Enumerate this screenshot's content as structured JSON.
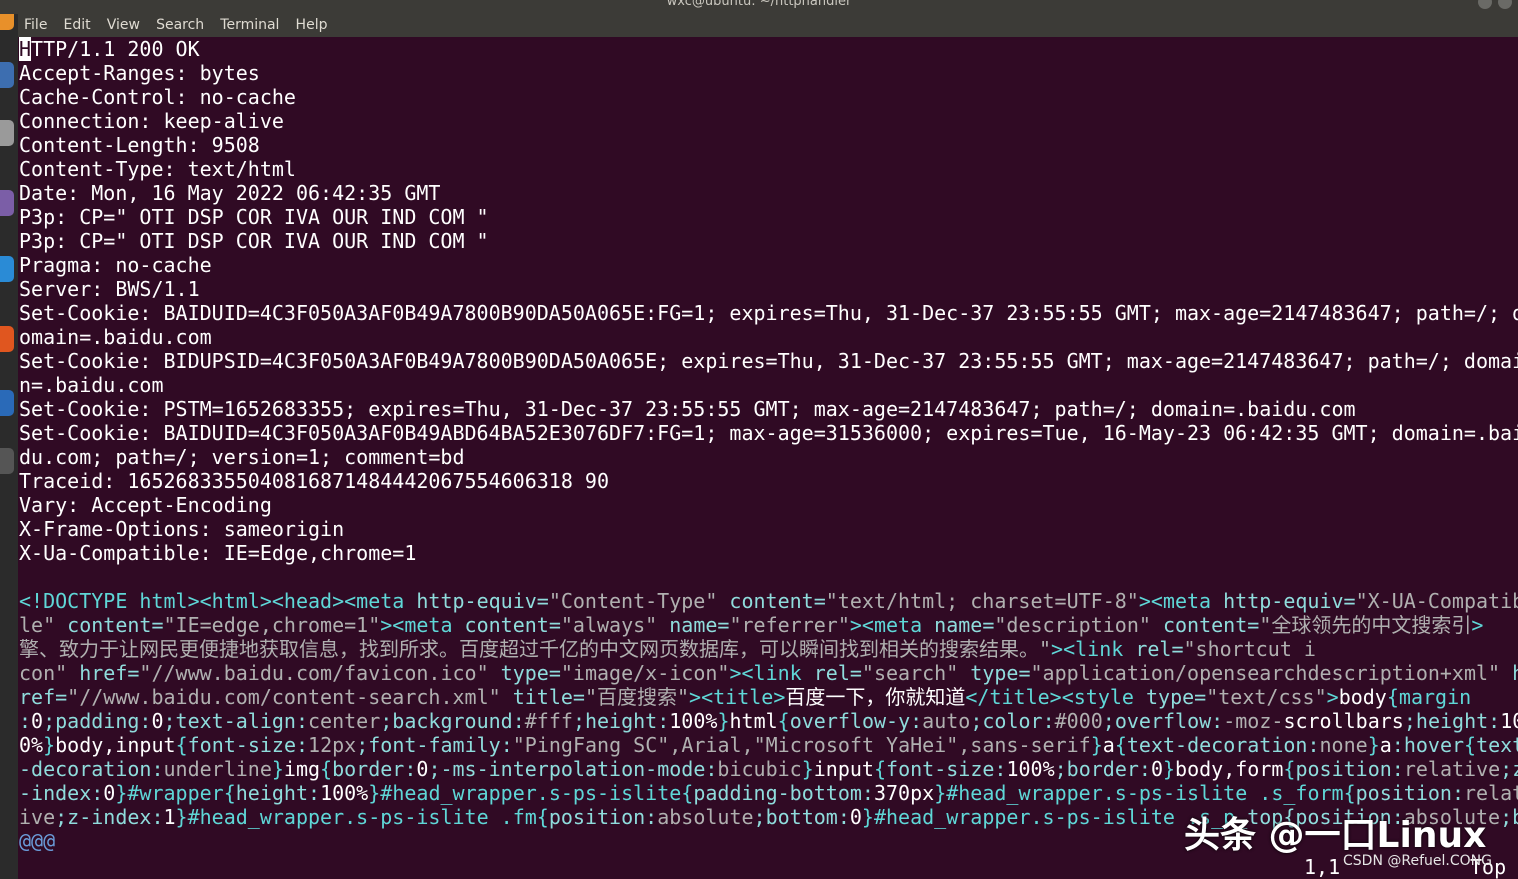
{
  "window": {
    "title": "wxc@ubuntu: ~/httphandler"
  },
  "menu": [
    "File",
    "Edit",
    "View",
    "Search",
    "Terminal",
    "Help"
  ],
  "headers": [
    "HTTP/1.1 200 OK",
    "Accept-Ranges: bytes",
    "Cache-Control: no-cache",
    "Connection: keep-alive",
    "Content-Length: 9508",
    "Content-Type: text/html",
    "Date: Mon, 16 May 2022 06:42:35 GMT",
    "P3p: CP=\" OTI DSP COR IVA OUR IND COM \"",
    "P3p: CP=\" OTI DSP COR IVA OUR IND COM \"",
    "Pragma: no-cache",
    "Server: BWS/1.1",
    "Set-Cookie: BAIDUID=4C3F050A3AF0B49A7800B90DA50A065E:FG=1; expires=Thu, 31-Dec-37 23:55:55 GMT; max-age=2147483647; path=/; d",
    "omain=.baidu.com",
    "Set-Cookie: BIDUPSID=4C3F050A3AF0B49A7800B90DA50A065E; expires=Thu, 31-Dec-37 23:55:55 GMT; max-age=2147483647; path=/; domai",
    "n=.baidu.com",
    "Set-Cookie: PSTM=1652683355; expires=Thu, 31-Dec-37 23:55:55 GMT; max-age=2147483647; path=/; domain=.baidu.com",
    "Set-Cookie: BAIDUID=4C3F050A3AF0B49ABD64BA52E3076DF7:FG=1; max-age=31536000; expires=Tue, 16-May-23 06:42:35 GMT; domain=.bai",
    "du.com; path=/; version=1; comment=bd",
    "Traceid: 1652683355040816871484442067554606318 90",
    "Vary: Accept-Encoding",
    "X-Frame-Options: sameorigin",
    "X-Ua-Compatible: IE=Edge,chrome=1",
    ""
  ],
  "html_lines": [
    [
      [
        "t",
        "<!DOCTYPE html><html><head><meta "
      ],
      [
        "a",
        "http-equiv="
      ],
      [
        "s",
        "\"Content-Type\""
      ],
      [
        "a",
        " content="
      ],
      [
        "s",
        "\"text/html; charset=UTF-8\""
      ],
      [
        "t",
        "><meta "
      ],
      [
        "a",
        "http-equiv="
      ],
      [
        "s",
        "\"X-UA-Compatib"
      ]
    ],
    [
      [
        "s",
        "le\""
      ],
      [
        "a",
        " content="
      ],
      [
        "s",
        "\"IE=edge,chrome=1\""
      ],
      [
        "t",
        "><meta "
      ],
      [
        "a",
        "content="
      ],
      [
        "s",
        "\"always\""
      ],
      [
        "a",
        " name="
      ],
      [
        "s",
        "\"referrer\""
      ],
      [
        "t",
        "><meta "
      ],
      [
        "a",
        "name="
      ],
      [
        "s",
        "\"description\""
      ],
      [
        "a",
        " content="
      ],
      [
        "s",
        "\"全球领先的中文搜索引"
      ],
      [
        "t",
        ">"
      ]
    ],
    [
      [
        "s",
        "擎、致力于让网民更便捷地获取信息，找到所求。百度超过千亿的中文网页数据库，可以瞬间找到相关的搜索结果。\""
      ],
      [
        "t",
        "><link "
      ],
      [
        "a",
        "rel="
      ],
      [
        "s",
        "\"shortcut i"
      ]
    ],
    [
      [
        "s",
        "con\""
      ],
      [
        "a",
        " href="
      ],
      [
        "s",
        "\"//www.baidu.com/favicon.ico\""
      ],
      [
        "a",
        " type="
      ],
      [
        "s",
        "\"image/x-icon\""
      ],
      [
        "t",
        "><link "
      ],
      [
        "a",
        "rel="
      ],
      [
        "s",
        "\"search\""
      ],
      [
        "a",
        " type="
      ],
      [
        "s",
        "\"application/opensearchdescription+xml\""
      ],
      [
        "a",
        " h"
      ]
    ],
    [
      [
        "a",
        "ref="
      ],
      [
        "s",
        "\"//www.baidu.com/content-search.xml\""
      ],
      [
        "a",
        " title="
      ],
      [
        "s",
        "\"百度搜索\""
      ],
      [
        "t",
        "><title>"
      ],
      [
        "tx",
        "百度一下，你就知道"
      ],
      [
        "t",
        "</title><style "
      ],
      [
        "a",
        "type="
      ],
      [
        "s",
        "\"text/css\""
      ],
      [
        "t",
        ">"
      ],
      [
        "tx",
        "body"
      ],
      [
        "t",
        "{margin"
      ]
    ],
    [
      [
        "a",
        ":"
      ],
      [
        "tx",
        "0"
      ],
      [
        "a",
        ";padding:"
      ],
      [
        "tx",
        "0"
      ],
      [
        "a",
        ";text-align:"
      ],
      [
        "s",
        "center"
      ],
      [
        "a",
        ";background:"
      ],
      [
        "s",
        "#fff"
      ],
      [
        "a",
        ";height:"
      ],
      [
        "tx",
        "100%"
      ],
      [
        "t",
        "}"
      ],
      [
        "tx",
        "html"
      ],
      [
        "t",
        "{"
      ],
      [
        "a",
        "overflow-y:"
      ],
      [
        "s",
        "auto"
      ],
      [
        "a",
        ";color:"
      ],
      [
        "s",
        "#000"
      ],
      [
        "a",
        ";overflow:"
      ],
      [
        "s",
        "-moz-"
      ],
      [
        "tx",
        "scrollbars"
      ],
      [
        "a",
        ";height:"
      ],
      [
        "tx",
        "10"
      ]
    ],
    [
      [
        "tx",
        "0%"
      ],
      [
        "t",
        "}"
      ],
      [
        "tx",
        "body,input"
      ],
      [
        "t",
        "{"
      ],
      [
        "a",
        "font-size:"
      ],
      [
        "s",
        "12px"
      ],
      [
        "a",
        ";font-family:"
      ],
      [
        "s",
        "\"PingFang SC\",Arial,\"Microsoft YaHei\",sans-serif"
      ],
      [
        "t",
        "}"
      ],
      [
        "tx",
        "a"
      ],
      [
        "t",
        "{"
      ],
      [
        "a",
        "text-decoration:"
      ],
      [
        "s",
        "none"
      ],
      [
        "t",
        "}"
      ],
      [
        "tx",
        "a"
      ],
      [
        "a",
        ":hover"
      ],
      [
        "t",
        "{"
      ],
      [
        "a",
        "text"
      ]
    ],
    [
      [
        "a",
        "-decoration:"
      ],
      [
        "s",
        "underline"
      ],
      [
        "t",
        "}"
      ],
      [
        "tx",
        "img"
      ],
      [
        "t",
        "{"
      ],
      [
        "a",
        "border:"
      ],
      [
        "tx",
        "0"
      ],
      [
        "a",
        ";-ms-interpolation-mode:"
      ],
      [
        "s",
        "bicubic"
      ],
      [
        "t",
        "}"
      ],
      [
        "tx",
        "input"
      ],
      [
        "t",
        "{"
      ],
      [
        "a",
        "font-size:"
      ],
      [
        "tx",
        "100%"
      ],
      [
        "a",
        ";border:"
      ],
      [
        "tx",
        "0"
      ],
      [
        "t",
        "}"
      ],
      [
        "tx",
        "body,form"
      ],
      [
        "t",
        "{"
      ],
      [
        "a",
        "position:"
      ],
      [
        "s",
        "relative"
      ],
      [
        "a",
        ";z"
      ]
    ],
    [
      [
        "a",
        "-index:"
      ],
      [
        "tx",
        "0"
      ],
      [
        "t",
        "}#wrapper{"
      ],
      [
        "a",
        "height:"
      ],
      [
        "tx",
        "100%"
      ],
      [
        "t",
        "}#head_wrapper.s-ps-islite{"
      ],
      [
        "a",
        "padding-bottom:"
      ],
      [
        "tx",
        "370px"
      ],
      [
        "t",
        "}#head_wrapper.s-ps-islite .s_form{"
      ],
      [
        "a",
        "position:"
      ],
      [
        "s",
        "relat"
      ]
    ],
    [
      [
        "s",
        "ive"
      ],
      [
        "a",
        ";z-index:"
      ],
      [
        "tx",
        "1"
      ],
      [
        "t",
        "}#head_wrapper.s-ps-islite .fm{"
      ],
      [
        "a",
        "position:"
      ],
      [
        "s",
        "absolute"
      ],
      [
        "a",
        ";bottom:"
      ],
      [
        "tx",
        "0"
      ],
      [
        "t",
        "}#head_wrapper.s-ps-islite .s_p"
      ],
      [
        "a",
        "_top{position:"
      ],
      [
        "s",
        "absolute"
      ],
      [
        "a",
        ";b"
      ]
    ],
    [
      [
        "cp",
        "@@@"
      ]
    ]
  ],
  "status": {
    "position": "1,1",
    "scroll": "Top"
  },
  "watermarks": {
    "toutiao": "头条 @一口Linux",
    "csdn": "CSDN @Refuel.CONG"
  }
}
